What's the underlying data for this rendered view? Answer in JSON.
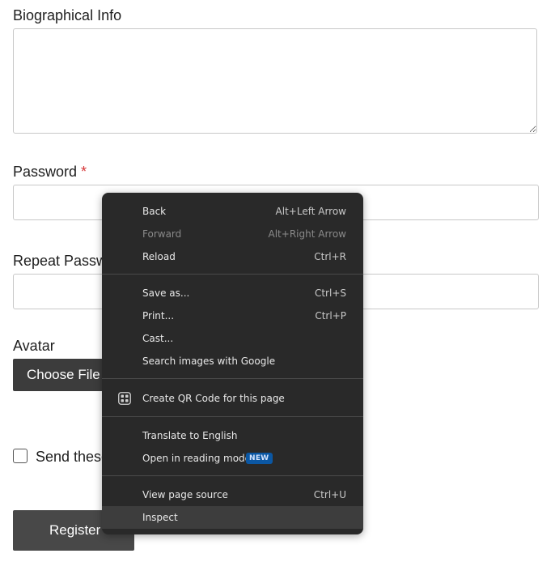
{
  "form": {
    "bio_label": "Biographical Info",
    "password_label": "Password",
    "required_marker": "*",
    "repeat_password_label": "Repeat Passw",
    "avatar_label": "Avatar",
    "choose_file_label": "Choose File",
    "checkbox_label": "Send these",
    "register_label": "Register"
  },
  "context_menu": {
    "items": [
      {
        "label": "Back",
        "shortcut": "Alt+Left Arrow"
      },
      {
        "label": "Forward",
        "shortcut": "Alt+Right Arrow",
        "disabled": true
      },
      {
        "label": "Reload",
        "shortcut": "Ctrl+R"
      },
      {
        "label": "Save as...",
        "shortcut": "Ctrl+S"
      },
      {
        "label": "Print...",
        "shortcut": "Ctrl+P"
      },
      {
        "label": "Cast...",
        "shortcut": ""
      },
      {
        "label": "Search images with Google",
        "shortcut": ""
      },
      {
        "label": "Create QR Code for this page",
        "icon": "qr-code-icon"
      },
      {
        "label": "Translate to English",
        "shortcut": ""
      },
      {
        "label": "Open in reading mode",
        "badge": "NEW"
      },
      {
        "label": "View page source",
        "shortcut": "Ctrl+U"
      },
      {
        "label": "Inspect",
        "shortcut": "",
        "highlighted": true
      }
    ]
  },
  "colors": {
    "menu_background": "#292929",
    "menu_highlight": "#3d3d3d",
    "badge_background": "#0b57a3",
    "required_red": "#d63638",
    "button_dark": "#3c3c3c"
  }
}
